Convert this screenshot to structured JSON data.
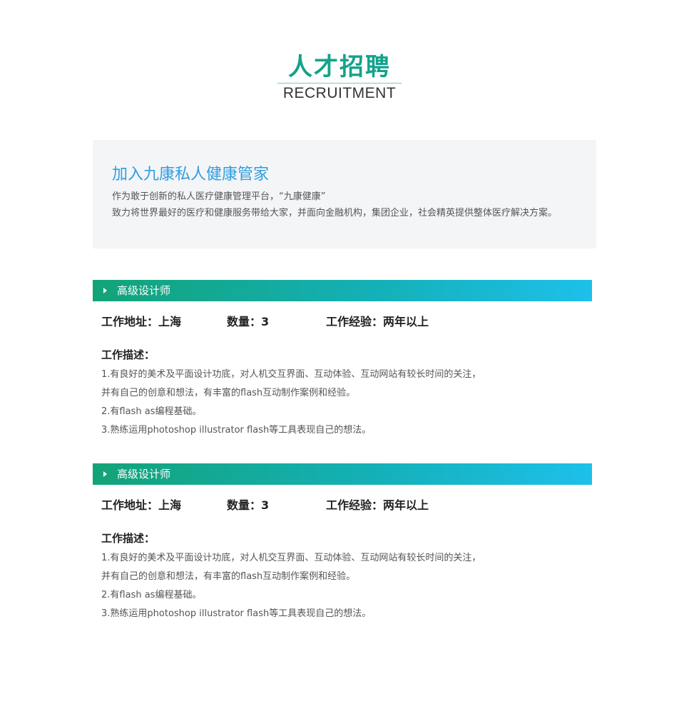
{
  "header": {
    "title": "人才招聘",
    "subtitle": "RECRUITMENT"
  },
  "intro": {
    "title": "加入九康私人健康管家",
    "line1": "作为敢于创新的私人医疗健康管理平台，“九康健康”",
    "line2": "致力将世界最好的医疗和健康服务带给大家，并面向金融机构，集团企业，社会精英提供整体医疗解决方案。"
  },
  "jobs": [
    {
      "title": "高级设计师",
      "location_label": "工作地址：",
      "location": "上海",
      "count_label": "数量：",
      "count": "3",
      "experience_label": "工作经验：",
      "experience": "两年以上",
      "desc_label": "工作描述：",
      "desc": [
        "1.有良好的美术及平面设计功底，对人机交互界面、互动体验、互动网站有较长时间的关注，",
        "并有自己的创意和想法，有丰富的flash互动制作案例和经验。",
        "2.有flash as编程基础。",
        "3.熟练运用photoshop illustrator flash等工具表现自己的想法。"
      ]
    },
    {
      "title": "高级设计师",
      "location_label": "工作地址：",
      "location": "上海",
      "count_label": "数量：",
      "count": "3",
      "experience_label": "工作经验：",
      "experience": "两年以上",
      "desc_label": "工作描述：",
      "desc": [
        "1.有良好的美术及平面设计功底，对人机交互界面、互动体验、互动网站有较长时间的关注，",
        "并有自己的创意和想法，有丰富的flash互动制作案例和经验。",
        "2.有flash as编程基础。",
        "3.熟练运用photoshop illustrator flash等工具表现自己的想法。"
      ]
    }
  ],
  "colors": {
    "title_green": "#12a38a",
    "intro_blue": "#2f9ee0",
    "bar_start": "#13a378",
    "bar_end": "#1dc0ea"
  }
}
